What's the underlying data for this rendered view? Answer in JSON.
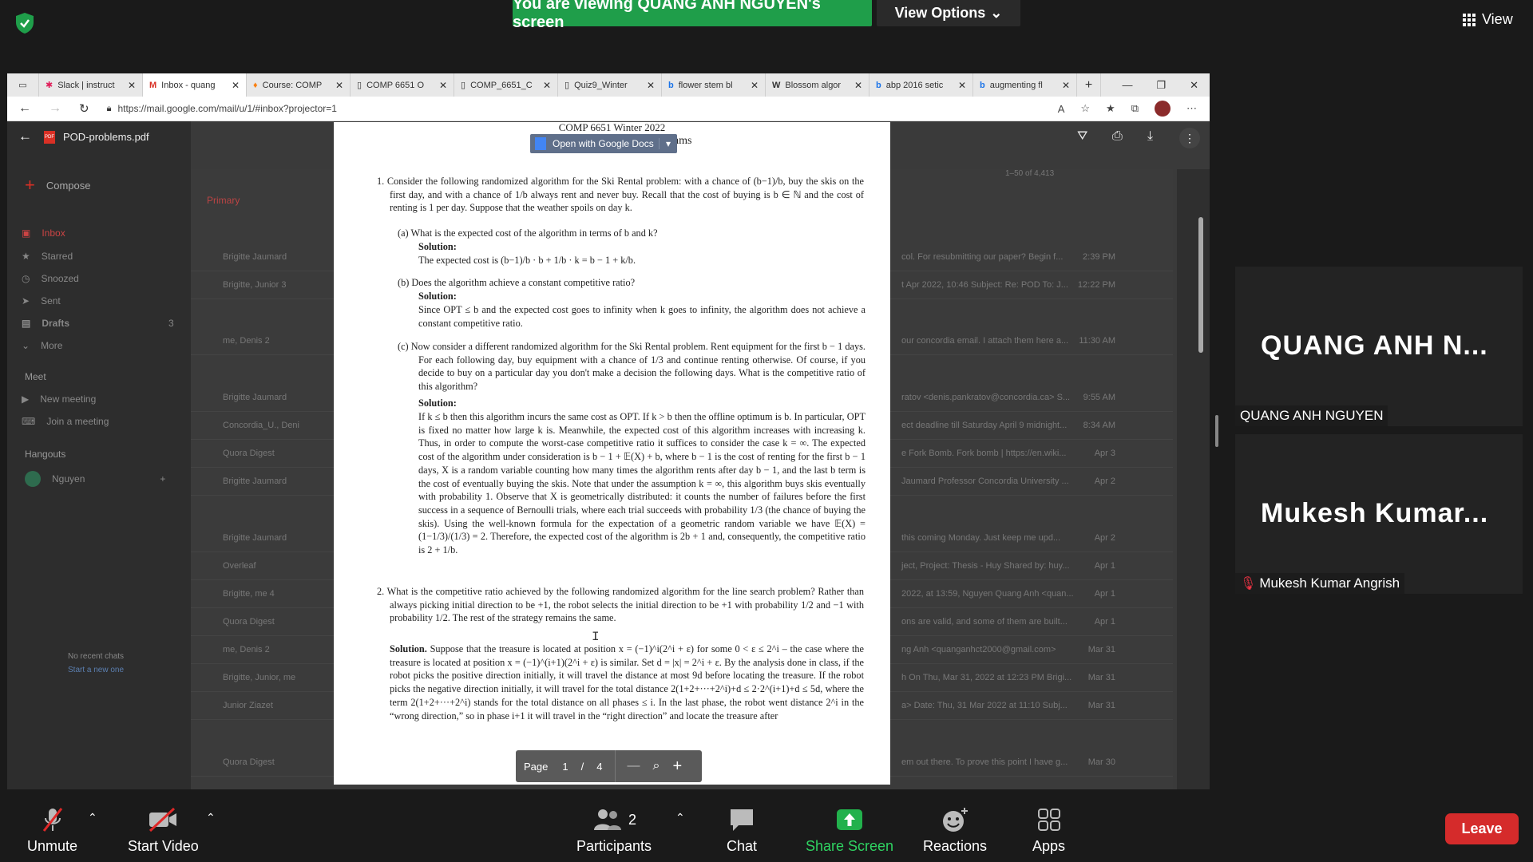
{
  "zoom": {
    "banner": "You are viewing QUANG ANH NGUYEN's screen",
    "view_options": "View Options",
    "view": "View",
    "leave": "Leave",
    "toolbar": {
      "unmute": "Unmute",
      "start_video": "Start Video",
      "participants": "Participants",
      "participants_count": "2",
      "chat": "Chat",
      "share_screen": "Share Screen",
      "reactions": "Reactions",
      "apps": "Apps"
    },
    "tiles": [
      {
        "name_big": "QUANG ANH N...",
        "label": "QUANG ANH NGUYEN"
      },
      {
        "name_big": "Mukesh Kumar...",
        "label": "Mukesh Kumar Angrish"
      }
    ],
    "accent": "#1f9e4a",
    "leave_color": "#d52b2b"
  },
  "browser": {
    "tabs": [
      {
        "label": "Slack | instruct"
      },
      {
        "label": "Inbox - quang"
      },
      {
        "label": "Course: COMP"
      },
      {
        "label": "COMP 6651 O"
      },
      {
        "label": "COMP_6651_C"
      },
      {
        "label": "Quiz9_Winter"
      },
      {
        "label": "flower stem bl"
      },
      {
        "label": "Blossom algor"
      },
      {
        "label": "abp 2016 setic"
      },
      {
        "label": "augmenting fl"
      }
    ],
    "url": "https://mail.google.com/mail/u/1/#inbox?projector=1"
  },
  "gmail": {
    "compose": "Compose",
    "nav": [
      "Inbox",
      "Starred",
      "Snoozed",
      "Sent",
      "Drafts",
      "More"
    ],
    "drafts_count": "3",
    "meet_header": "Meet",
    "meet_items": [
      "New meeting",
      "Join a meeting"
    ],
    "hangouts_header": "Hangouts",
    "hangouts_user": "Nguyen",
    "no_recent": "No recent chats",
    "start_new": "Start a new one",
    "primary_tab": "Primary",
    "pagination": "1–50 of 4,413",
    "rows": [
      {
        "from": "Brigitte Jaumard",
        "snip": "col. For resubmitting our paper? Begin f...",
        "date": "2:39 PM"
      },
      {
        "from": "Brigitte, Junior 3",
        "snip": "t Apr 2022, 10:46 Subject: Re: POD To: J...",
        "date": "12:22 PM"
      },
      {
        "from": "me, Denis 2",
        "snip": "our concordia email. I attach them here a...",
        "date": "11:30 AM"
      },
      {
        "from": "Brigitte Jaumard",
        "snip": "ratov <denis.pankratov@concordia.ca> S...",
        "date": "9:55 AM"
      },
      {
        "from": "Concordia_U., Deni",
        "snip": "ect deadline till Saturday April 9 midnight...",
        "date": "8:34 AM"
      },
      {
        "from": "Quora Digest",
        "snip": "e Fork Bomb. Fork bomb | https://en.wiki...",
        "date": "Apr 3"
      },
      {
        "from": "Brigitte Jaumard",
        "snip": "Jaumard Professor Concordia University ...",
        "date": "Apr 2"
      },
      {
        "from": "Brigitte Jaumard",
        "snip": "this coming Monday. Just keep me upd...",
        "date": "Apr 2"
      },
      {
        "from": "Overleaf",
        "snip": "ject, Project: Thesis - Huy Shared by: huy...",
        "date": "Apr 1"
      },
      {
        "from": "Brigitte, me 4",
        "snip": "2022, at 13:59, Nguyen Quang Anh <quan...",
        "date": "Apr 1"
      },
      {
        "from": "Quora Digest",
        "snip": "ons are valid, and some of them are built...",
        "date": "Apr 1"
      },
      {
        "from": "me, Denis 2",
        "snip": "ng Anh <quanganhct2000@gmail.com>",
        "date": "Mar 31"
      },
      {
        "from": "Brigitte, Junior, me",
        "snip": "h On Thu, Mar 31, 2022 at 12:23 PM Brigi...",
        "date": "Mar 31"
      },
      {
        "from": "Junior Ziazet",
        "snip": "a> Date: Thu, 31 Mar 2022 at 11:10 Subj...",
        "date": "Mar 31"
      },
      {
        "from": "Quora Digest",
        "snip": "em out there. To prove this point I have g...",
        "date": "Mar 30"
      }
    ]
  },
  "pdf": {
    "filename": "POD-problems.pdf",
    "open_with": "Open with Google Docs",
    "page_label": "Page",
    "page_current": "1",
    "page_sep": "/",
    "page_total": "4",
    "title1": "COMP 6651 Winter 2022",
    "title2": "POD Session on Online Algorithms",
    "q1": "1.  Consider the following randomized algorithm for the Ski Rental problem: with a chance of (b−1)/b, buy the skis on the first day, and with a chance of 1/b always rent and never buy. Recall that the cost of buying is b ∈ ℕ and the cost of renting is 1 per day. Suppose that the weather spoils on day k.",
    "qa": "(a)  What is the expected cost of the algorithm in terms of b and k?",
    "sol": "Solution:",
    "qa_sol": "The expected cost is (b−1)/b · b + 1/b · k = b − 1 + k/b.",
    "qb": "(b)  Does the algorithm achieve a constant competitive ratio?",
    "qb_sol": "Since OPT ≤ b and the expected cost goes to infinity when k goes to infinity, the algorithm does not achieve a constant competitive ratio.",
    "qc": "(c)  Now consider a different randomized algorithm for the Ski Rental problem. Rent equipment for the first b − 1 days. For each following day, buy equipment with a chance of 1/3 and continue renting otherwise. Of course, if you decide to buy on a particular day you don't make a decision the following days. What is the competitive ratio of this algorithm?",
    "qc_sol": "If k ≤ b then this algorithm incurs the same cost as OPT. If k > b then the offline optimum is b. In particular, OPT is fixed no matter how large k is. Meanwhile, the expected cost of this algorithm increases with increasing k. Thus, in order to compute the worst-case competitive ratio it suffices to consider the case k = ∞. The expected cost of the algorithm under consideration is b − 1 + 𝔼(X) + b, where b − 1 is the cost of renting for the first b − 1 days, X is a random variable counting how many times the algorithm rents after day b − 1, and the last b term is the cost of eventually buying the skis. Note that under the assumption k = ∞, this algorithm buys skis eventually with probability 1. Observe that X is geometrically distributed: it counts the number of failures before the first success in a sequence of Bernoulli trials, where each trial succeeds with probability 1/3 (the chance of buying the skis). Using the well-known formula for the expectation of a geometric random variable we have 𝔼(X) = (1−1/3)/(1/3) = 2. Therefore, the expected cost of the algorithm is 2b + 1 and, consequently, the competitive ratio is 2 + 1/b.",
    "q2": "2.  What is the competitive ratio achieved by the following randomized algorithm for the line search problem? Rather than always picking initial direction to be +1, the robot selects the initial direction to be +1 with probability 1/2 and −1 with probability 1/2. The rest of the strategy remains the same.",
    "q2_sol_label": "Solution.",
    "q2_sol": "Suppose that the treasure is located at position x = (−1)^i(2^i + ε) for some 0 < ε ≤ 2^i – the case where the treasure is located at position x = (−1)^(i+1)(2^i + ε) is similar. Set d = |x| = 2^i + ε. By the analysis done in class, if the robot picks the positive direction initially, it will travel the distance at most 9d before locating the treasure. If the robot picks the negative direction initially, it will travel for the total distance 2(1+2+···+2^i)+d ≤ 2·2^(i+1)+d ≤ 5d, where the term 2(1+2+···+2^i) stands for the total distance on all phases ≤ i. In the last phase, the robot went distance 2^i in the “wrong direction,” so in phase i+1 it will travel in the “right direction” and locate the treasure after"
  }
}
